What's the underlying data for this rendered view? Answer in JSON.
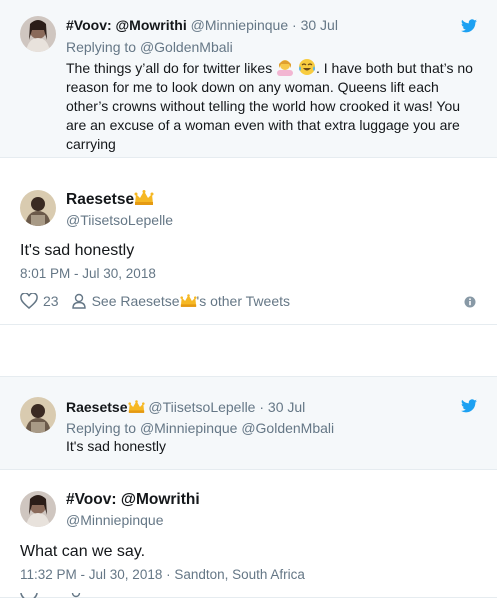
{
  "tweet1": {
    "display_name": "#Voov: @Mowrithi",
    "handle": "@Minniepinque",
    "separator": "·",
    "date": "30 Jul",
    "replying_prefix": "Replying to",
    "replying_to": "@GoldenMbali",
    "text_before": "The things y’all do for twitter likes",
    "text_after": ". I have both but that’s no reason for me to look down on any woman. Queens lift each other’s crowns without telling the world how crooked it was! You are an excuse of a woman even with that extra luggage you are carrying"
  },
  "tweet2": {
    "display_name": "Raesetse",
    "handle": "@TiisetsoLepelle",
    "text": "It's sad honestly",
    "timestamp": "8:01 PM - Jul 30, 2018",
    "like_count": "23",
    "see_other_prefix": "See Raesetse",
    "see_other_suffix": "'s other Tweets"
  },
  "tweet3": {
    "display_name": "Raesetse",
    "handle": "@TiisetsoLepelle",
    "separator": "·",
    "date": "30 Jul",
    "replying_prefix": "Replying to",
    "replying_to": "@Minniepinque @GoldenMbali",
    "text": "It's sad honestly"
  },
  "tweet4": {
    "display_name": "#Voov: @Mowrithi",
    "handle": "@Minniepinque",
    "text": "What can we say.",
    "timestamp": "11:32 PM - Jul 30, 2018 · Sandton, South Africa"
  },
  "colors": {
    "twitter_blue": "#1da1f2",
    "muted": "#657786",
    "reply_bg": "#f5f8fa"
  },
  "icons": [
    "twitter-bird-icon",
    "crown-emoji-icon",
    "woman-shrugging-emoji-icon",
    "tears-of-joy-emoji-icon",
    "heart-icon",
    "person-icon",
    "info-icon"
  ]
}
